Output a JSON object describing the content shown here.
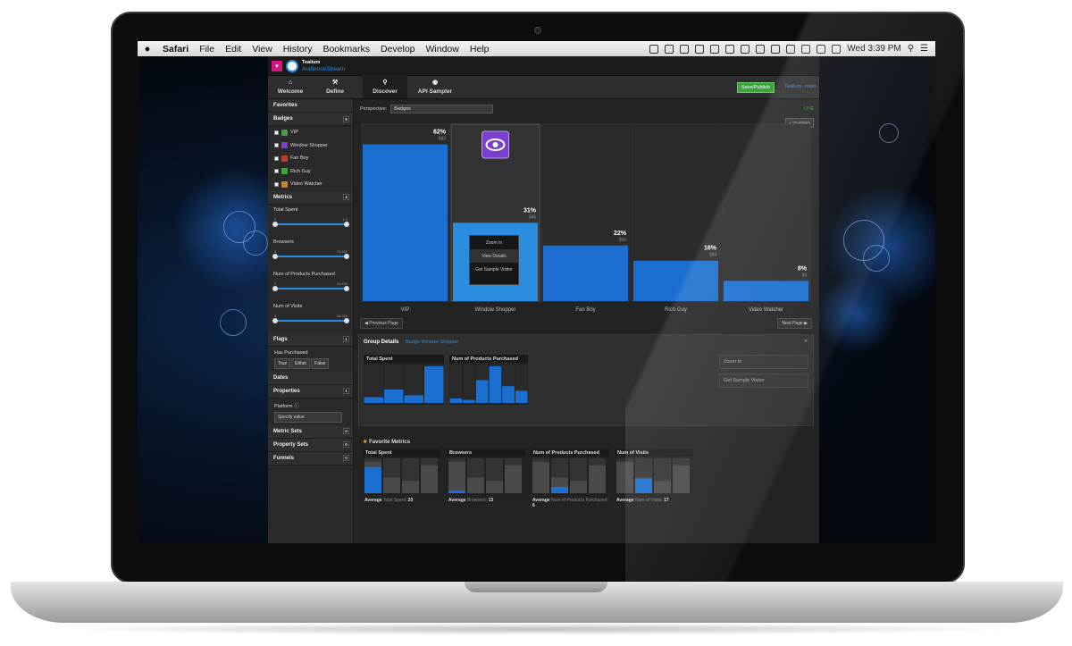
{
  "menubar": {
    "app": "Safari",
    "items": [
      "File",
      "Edit",
      "View",
      "History",
      "Bookmarks",
      "Develop",
      "Window",
      "Help"
    ],
    "clock": "Wed 3:39 PM"
  },
  "brand": {
    "line1": "Tealium",
    "line2": "AudienceStream"
  },
  "nav": {
    "tabs": [
      "Welcome",
      "Define",
      "Discover",
      "API Sampler"
    ],
    "save_label": "Save/Publish",
    "link1": "Tealium",
    "link2": "main"
  },
  "sidebar": {
    "favorites": "Favorites",
    "badges_title": "Badges",
    "badges_count": "5",
    "badges": [
      {
        "label": "VIP",
        "color": "#3da33d"
      },
      {
        "label": "Window Shopper",
        "color": "#7b3fd0"
      },
      {
        "label": "Fan Boy",
        "color": "#c0392b"
      },
      {
        "label": "Rich Guy",
        "color": "#3da33d"
      },
      {
        "label": "Video Watcher",
        "color": "#d4801a"
      }
    ],
    "metrics_title": "Metrics",
    "metrics_count": "4",
    "metrics": [
      {
        "label": "Total Spent",
        "min": "0",
        "max": "1.5"
      },
      {
        "label": "Browsers",
        "min": "0",
        "max": "74.632"
      },
      {
        "label": "Num of Products Purchased",
        "min": "0",
        "max": "25.435"
      },
      {
        "label": "Num of Visits",
        "min": "0",
        "max": "36.328"
      }
    ],
    "flags_title": "Flags",
    "flags_count": "1",
    "has_purchased": "Has Purchased",
    "flag_options": [
      "True",
      "Either",
      "False"
    ],
    "dates": "Dates",
    "properties": "Properties",
    "properties_count": "1",
    "platform": "Platform",
    "specify": "Specify value",
    "metric_sets": "Metric Sets",
    "property_sets": "Property Sets",
    "funnels": "Funnels",
    "zero": "0"
  },
  "discover": {
    "perspective_label": "Perspective:",
    "perspective_value": "Badges",
    "live": "LIVE",
    "visitors": "+ 10 visitors",
    "prev": "Previous Page",
    "next": "Next Page",
    "popup": [
      "Zoom In",
      "View Details",
      "Get Sample Visitor"
    ]
  },
  "chart_data": {
    "type": "bar",
    "categories": [
      "VIP",
      "Window Shopper",
      "Fan Boy",
      "Rich Guy",
      "Video Watcher"
    ],
    "values": [
      62,
      31,
      22,
      16,
      8
    ],
    "counts": [
      "683",
      "345",
      "256",
      "183",
      "94"
    ],
    "unit": "%",
    "ylim": [
      0,
      70
    ],
    "selected": "Window Shopper",
    "bar_color": "#1a6fd0",
    "selected_color": "#2b8de0"
  },
  "group": {
    "title": "Group Details",
    "link": "Badge Window Shopper",
    "chart1_title": "Total Spent",
    "chart1_values": [
      3,
      7,
      4,
      19
    ],
    "chart2_title": "Num of Products Purchased",
    "chart2_values": [
      3,
      2,
      15,
      24,
      11,
      8
    ],
    "btn_zoom": "Zoom In",
    "btn_sample": "Get Sample Visitor"
  },
  "favorites": {
    "title": "Favorite Metrics",
    "avg_label": "Average",
    "cards": [
      {
        "title": "Total Spent",
        "avg_name": "Total Spent:",
        "avg_value": "20",
        "highlight": 0.75
      },
      {
        "title": "Browsers",
        "avg_name": "Browsers:",
        "avg_value": "13",
        "highlight": 0.08
      },
      {
        "title": "Num of Products Purchased",
        "avg_name": "Num of Products Purchased:",
        "avg_value": "6",
        "highlight": 0.18
      },
      {
        "title": "Num of Visits",
        "avg_name": "Num of Visits:",
        "avg_value": "17",
        "highlight": 0.42
      }
    ]
  }
}
